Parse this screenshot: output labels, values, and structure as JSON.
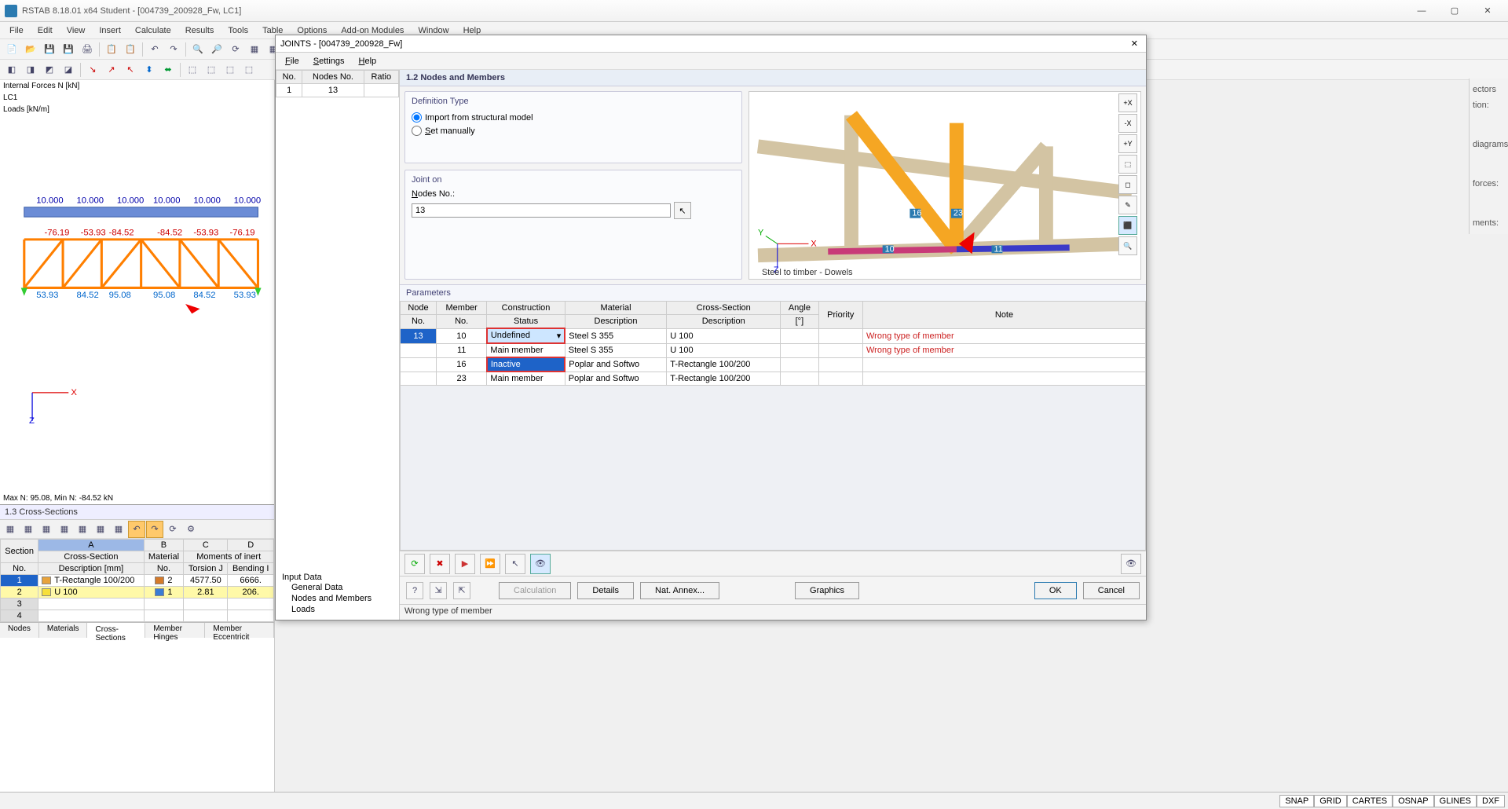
{
  "app": {
    "title": "RSTAB 8.18.01 x64 Student - [004739_200928_Fw, LC1]",
    "menus": [
      "File",
      "Edit",
      "View",
      "Insert",
      "Calculate",
      "Results",
      "Tools",
      "Table",
      "Options",
      "Add-on Modules",
      "Window",
      "Help"
    ]
  },
  "diagram": {
    "title": "Internal Forces N [kN]",
    "lc": "LC1",
    "loads": "Loads [kN/m]",
    "footer": "Max N: 95.08, Min N: -84.52 kN",
    "top_values": [
      "10.000",
      "10.000",
      "10.000",
      "10.000",
      "10.000",
      "10.000"
    ],
    "mid_values": [
      "-76.19",
      "-53.93",
      "-84.52",
      "-84.52",
      "-53.93",
      "-76.19"
    ],
    "bot_values": [
      "53.93",
      "84.52",
      "95.08",
      "95.08",
      "84.52",
      "53.93"
    ]
  },
  "cross": {
    "title": "1.3 Cross-Sections",
    "col_a": "A",
    "col_b": "B",
    "col_c": "C",
    "col_d": "D",
    "hdr_section": "Section",
    "hdr_no": "No.",
    "hdr_cs": "Cross-Section",
    "hdr_desc": "Description [mm]",
    "hdr_mat": "Material",
    "hdr_matno": "No.",
    "hdr_moi": "Moments of inert",
    "hdr_tors": "Torsion J",
    "hdr_bend": "Bending I",
    "rows": [
      {
        "n": "1",
        "desc": "T-Rectangle 100/200",
        "mat": "2",
        "tors": "4577.50",
        "bend": "6666.",
        "color": "#e8a33c"
      },
      {
        "n": "2",
        "desc": "U 100",
        "mat": "1",
        "tors": "2.81",
        "bend": "206.",
        "color": "#f6df3a"
      }
    ],
    "tabs": [
      "Nodes",
      "Materials",
      "Cross-Sections",
      "Member Hinges",
      "Member Eccentricit"
    ]
  },
  "dialog": {
    "title": "JOINTS - [004739_200928_Fw]",
    "menus": [
      "File",
      "Settings",
      "Help"
    ],
    "mini": {
      "h1": "No.",
      "h2": "Nodes No.",
      "h3": "Ratio",
      "r1": "1",
      "r2": "13"
    },
    "tree_root": "Input Data",
    "tree": [
      "General Data",
      "Nodes and Members",
      "Loads"
    ],
    "section": "1.2 Nodes and Members",
    "def_title": "Definition Type",
    "def_opt1": "Import from structural model",
    "def_opt2": "Set manually",
    "joint_title": "Joint on",
    "nodes_label": "Nodes No.:",
    "nodes_value": "13",
    "preview_caption": "Steel to timber - Dowels",
    "preview_members": {
      "m10": "10",
      "m16": "16",
      "m23": "23",
      "m11": "11"
    },
    "params_title": "Parameters",
    "cols": {
      "node": "Node",
      "nodeNo": "No.",
      "member": "Member",
      "memberNo": "No.",
      "cons": "Construction",
      "status": "Status",
      "mat": "Material",
      "matdesc": "Description",
      "cs": "Cross-Section",
      "csdesc": "Description",
      "angle": "Angle",
      "angleU": "[°]",
      "prio": "Priority",
      "note": "Note"
    },
    "rows": [
      {
        "node": "13",
        "member": "10",
        "status": "Undefined",
        "statusDrop": true,
        "mat": "Steel S 355",
        "cs": "U 100",
        "note": "Wrong type of member"
      },
      {
        "node": "",
        "member": "11",
        "status": "Main member",
        "mat": "Steel S 355",
        "cs": "U 100",
        "note": "Wrong type of member"
      },
      {
        "node": "",
        "member": "16",
        "status": "Inactive",
        "statusHighlight": true,
        "mat": "Poplar and Softwo",
        "cs": "T-Rectangle 100/200",
        "note": ""
      },
      {
        "node": "",
        "member": "23",
        "status": "Main member",
        "mat": "Poplar and Softwo",
        "cs": "T-Rectangle 100/200",
        "note": ""
      }
    ],
    "btn_calc": "Calculation",
    "btn_details": "Details",
    "btn_annex": "Nat. Annex...",
    "btn_graphics": "Graphics",
    "btn_ok": "OK",
    "btn_cancel": "Cancel",
    "status": "Wrong type of member"
  },
  "rightStrip": [
    "ectors",
    "tion:",
    "diagrams:",
    "forces:",
    "ments:"
  ],
  "statusbar": [
    "SNAP",
    "GRID",
    "CARTES",
    "OSNAP",
    "GLINES",
    "DXF"
  ]
}
